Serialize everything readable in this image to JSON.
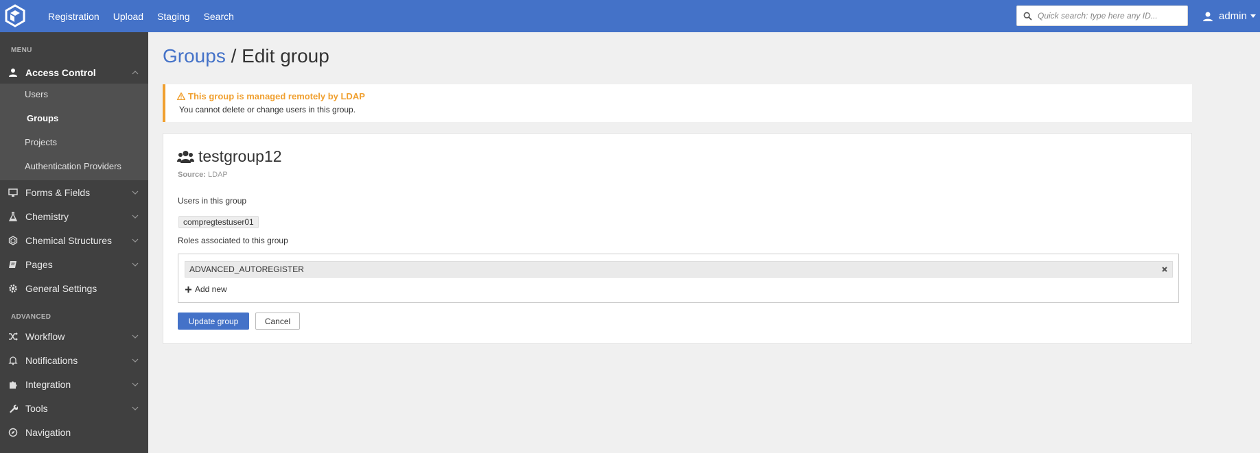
{
  "topbar": {
    "logo_icon": "hexagon-logo-icon",
    "nav": [
      "Registration",
      "Upload",
      "Staging",
      "Search"
    ],
    "quick_search_placeholder": "Quick search: type here any ID...",
    "quick_search_value": "",
    "user": "admin"
  },
  "sidebar": {
    "menu_label": "MENU",
    "advanced_label": "ADVANCED",
    "access_control": "Access Control",
    "sub_items": [
      "Users",
      "Groups",
      "Projects",
      "Authentication Providers"
    ],
    "items": [
      "Forms & Fields",
      "Chemistry",
      "Chemical Structures",
      "Pages",
      "General Settings"
    ],
    "advanced_items": [
      "Workflow",
      "Notifications",
      "Integration",
      "Tools",
      "Navigation"
    ]
  },
  "page": {
    "breadcrumb_link": "Groups",
    "separator": " / ",
    "title": "Edit group"
  },
  "alert": {
    "title": "This group is managed remotely by LDAP",
    "text": "You cannot delete or change users in this group."
  },
  "group": {
    "name": "testgroup12",
    "source_label": "Source:",
    "source_value": "LDAP",
    "users_label": "Users in this group",
    "users": [
      "compregtestuser01"
    ],
    "roles_label": "Roles associated to this group",
    "roles": [
      "ADVANCED_AUTOREGISTER"
    ],
    "add_new": "Add new",
    "update_button": "Update group",
    "cancel_button": "Cancel"
  },
  "colors": {
    "topbar": "#4472c8",
    "sidebar": "#404040",
    "warning": "#f0a030",
    "primary": "#4472c8"
  }
}
